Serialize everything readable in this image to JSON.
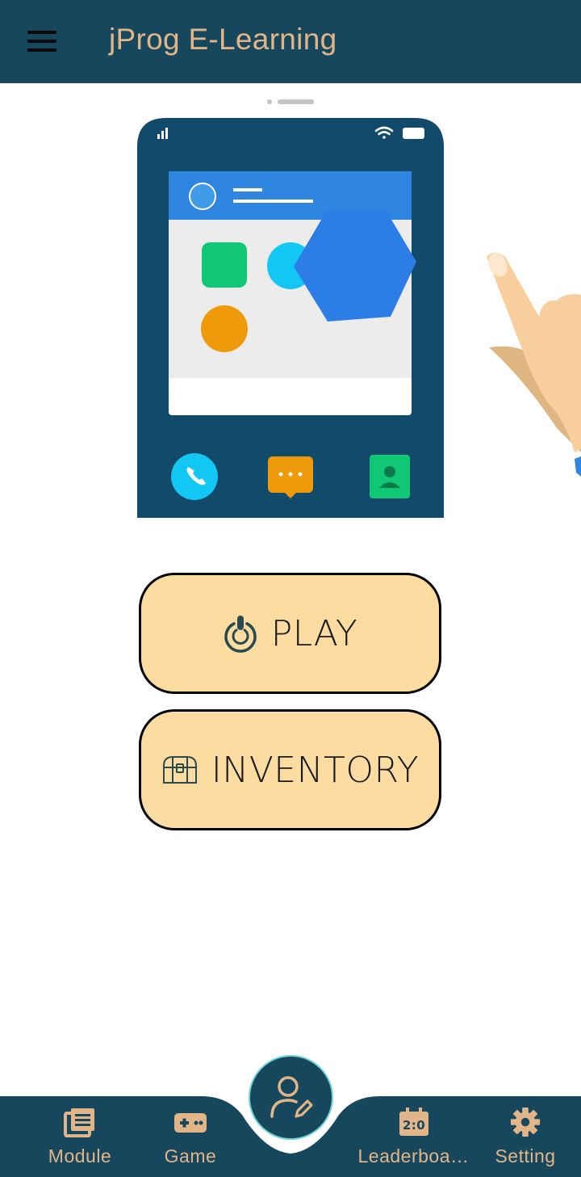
{
  "app": {
    "title": "jProg E-Learning",
    "menu_icon": "hamburger-menu-icon"
  },
  "carousel": {
    "pages": 2,
    "active": 1
  },
  "actions": {
    "play_label": "PLAY",
    "play_icon": "power-icon",
    "inventory_label": "INVENTORY",
    "inventory_icon": "treasure-chest-icon"
  },
  "bottom_nav": {
    "items": [
      {
        "label": "Module",
        "icon": "module-list-icon"
      },
      {
        "label": "Game",
        "icon": "gamepad-icon"
      },
      {
        "label": "Leaderboa…",
        "icon": "scoreboard-icon"
      },
      {
        "label": "Setting",
        "icon": "gear-icon"
      }
    ],
    "center_icon": "profile-edit-icon"
  },
  "colors": {
    "primary": "#17475c",
    "accent": "#e2b588",
    "button_fill": "#fddca2"
  }
}
